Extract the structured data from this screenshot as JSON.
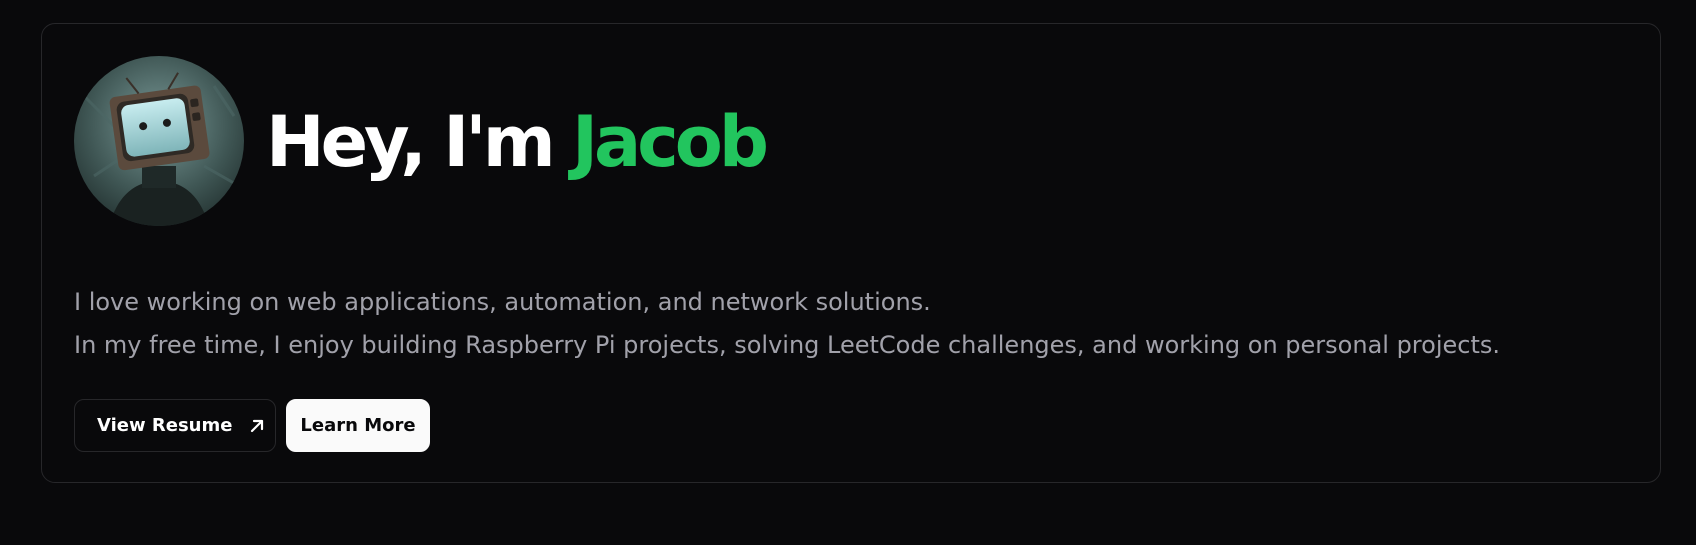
{
  "hero": {
    "greeting": "Hey, I'm",
    "name": "Jacob",
    "avatar_icon": "tv-head-portrait-icon",
    "bio_line_1": "I love working on web applications, automation, and network solutions.",
    "bio_line_2": "In my free time, I enjoy building Raspberry Pi projects, solving LeetCode challenges, and working on personal projects."
  },
  "actions": {
    "resume_label": "View Resume",
    "resume_icon": "arrow-up-right-icon",
    "learn_more_label": "Learn More"
  },
  "colors": {
    "background": "#09090b",
    "accent": "#22c55e",
    "border": "#27272a",
    "muted_text": "#a1a1aa"
  }
}
